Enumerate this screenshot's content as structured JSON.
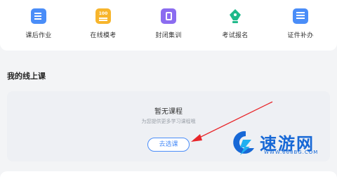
{
  "quick_nav": [
    {
      "label": "课后作业",
      "icon": "homework-icon"
    },
    {
      "label": "在线模考",
      "icon": "mock-exam-icon"
    },
    {
      "label": "封闭集训",
      "icon": "closed-training-icon"
    },
    {
      "label": "考试报名",
      "icon": "exam-registration-icon"
    },
    {
      "label": "证件补办",
      "icon": "certificate-icon"
    }
  ],
  "my_courses": {
    "title": "我的线上课",
    "empty_title": "暂无课程",
    "empty_subtitle": "为您提供更多学习课程哦",
    "select_button": "去选课"
  },
  "watermark": {
    "name": "速游网",
    "url": "WWW.668BG.COM"
  },
  "colors": {
    "accent": "#4a8df8",
    "annotation_arrow": "#e8262a",
    "watermark": "#1768d6"
  }
}
